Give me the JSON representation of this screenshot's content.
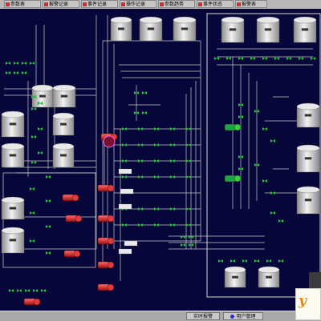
{
  "toolbar": {
    "buttons": [
      {
        "label": "参数表",
        "icon": "red-flag-icon"
      },
      {
        "label": "报警记录",
        "icon": "red-flag-icon"
      },
      {
        "label": "事件记录",
        "icon": "red-flag-icon"
      },
      {
        "label": "操作记录",
        "icon": "red-flag-icon"
      },
      {
        "label": "参数趋势",
        "icon": "red-flag-icon"
      },
      {
        "label": "事件状态",
        "icon": "red-flag-icon"
      },
      {
        "label": "报警表",
        "icon": "red-flag-icon"
      }
    ]
  },
  "bottombar": {
    "realtime_alarm": "实时报警",
    "user_manage": "用户管理"
  },
  "logo": {
    "text": "y"
  },
  "colors": {
    "background": "#06063a",
    "pipe": "#c8c8c8",
    "valve": "#2fd14a",
    "pump": "#d42a2a",
    "tank": "#d7d7d7",
    "selection_frame": "#d8d8d8",
    "toolbar": "#b8b8b8"
  }
}
